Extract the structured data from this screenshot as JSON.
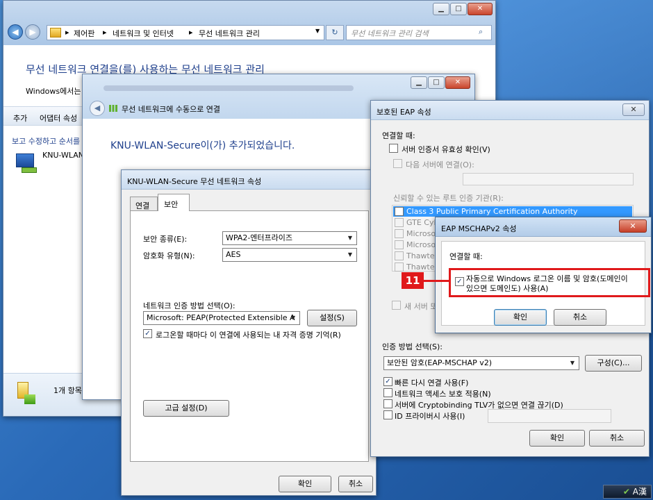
{
  "control_panel": {
    "breadcrumb": [
      "제어판",
      "네트워크 및 인터넷",
      "무선 네트워크 관리"
    ],
    "search_placeholder": "무선 네트워크 관리 검색",
    "heading": "무선 네트워크 연결을(를) 사용하는 무선 네트워크 관리",
    "description": "Windows에서는",
    "toolbar": [
      "추가",
      "어댑터 속성"
    ],
    "list_caption": "보고 수정하고 순서를",
    "network_item": "KNU-WLAN",
    "status": "1개 항목"
  },
  "manual_connect": {
    "title": "무선 네트워크에 수동으로 연결",
    "message": "KNU-WLAN-Secure이(가) 추가되었습니다."
  },
  "network_props": {
    "title": "KNU-WLAN-Secure 무선 네트워크 속성",
    "tabs": [
      "연결",
      "보안"
    ],
    "security_type_label": "보안 종류(E):",
    "security_type_value": "WPA2-엔터프라이즈",
    "encryption_label": "암호화 유형(N):",
    "encryption_value": "AES",
    "auth_method_label": "네트워크 인증 방법 선택(O):",
    "auth_method_value": "Microsoft: PEAP(Protected Extensible A",
    "settings_button": "설정(S)",
    "remember_label": "로그온할 때마다 이 연결에 사용되는 내 자격 증명 기억(R)",
    "advanced_button": "고급 설정(D)",
    "ok": "확인",
    "cancel": "취소"
  },
  "peap": {
    "title": "보호된 EAP 속성",
    "when_connecting": "연결할 때:",
    "validate_cert": "서버 인증서 유효성 확인(V)",
    "connect_servers": "다음 서버에 연결(O):",
    "trusted_ca": "신뢰할 수 있는 루트 인증 기관(R):",
    "ca_list": [
      "Class 3 Public Primary Certification Authority",
      "GTE Cyb",
      "Microso",
      "Microso",
      "Thawte F",
      "Thawte T"
    ],
    "new_server": "새 서버 또",
    "auth_method_label": "인증 방법 선택(S):",
    "auth_method_value": "보안된 암호(EAP-MSCHAP v2)",
    "configure_button": "구성(C)...",
    "options": [
      "빠른 다시 연결 사용(F)",
      "네트워크 액세스 보호 적용(N)",
      "서버에 Cryptobinding TLV가 없으면 연결 끊기(D)",
      "ID 프라이버시 사용(I)"
    ],
    "ok": "확인",
    "cancel": "취소"
  },
  "mschap": {
    "title": "EAP MSCHAPv2 속성",
    "when_connecting": "연결할 때:",
    "auto_logon_line1": "자동으로 Windows 로그온 이름 및 암호(도메인이",
    "auto_logon_line2": "있으면 도메인도) 사용(A)",
    "ok": "확인",
    "cancel": "취소"
  },
  "callout": {
    "number": "11",
    "color": "#e0191b"
  },
  "tray": {
    "ime": "A漢"
  }
}
